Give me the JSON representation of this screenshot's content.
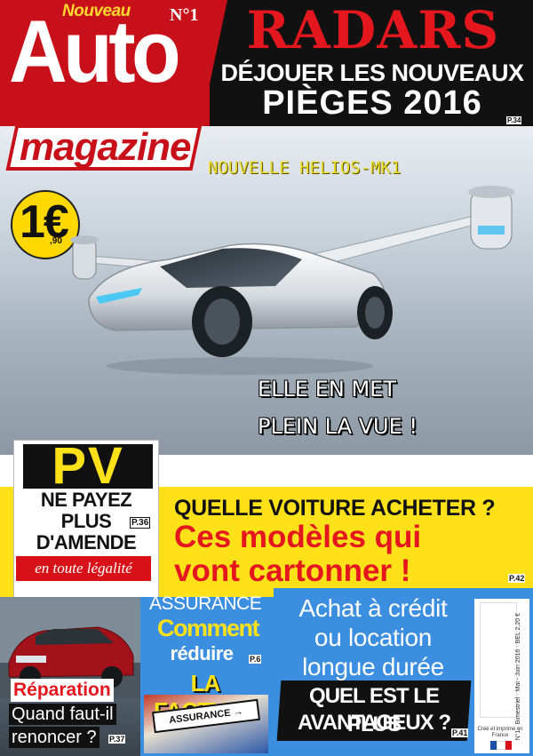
{
  "masthead": {
    "nouveau": "Nouveau",
    "auto": "Auto",
    "magazine": "magazine",
    "issue": "N°1",
    "price": "1€",
    "price_cents": ",90"
  },
  "headline": {
    "radars": "RADARS",
    "line1": "DÉJOUER LES NOUVEAUX",
    "line2": "PIÈGES 2016",
    "page": "P.34"
  },
  "hero": {
    "title": "NOUVELLE HELIOS-MK1",
    "tagline1": "ELLE EN MET",
    "tagline2": "PLEIN LA VUE !"
  },
  "pv": {
    "heading": "PV",
    "line1": "NE PAYEZ",
    "line2": "PLUS",
    "line3": "D'AMENDE",
    "page": "P.36",
    "ribbon": "en toute légalité"
  },
  "feature": {
    "question": "QUELLE VOITURE ACHETER ?",
    "headline1": "Ces modèles qui",
    "headline2": "vont cartonner !",
    "page": "P.42"
  },
  "repair": {
    "title": "Réparation",
    "line1": "Quand faut-il",
    "line2": "renoncer ?",
    "page": "P.37"
  },
  "insurance": {
    "title": "ASSURANCE",
    "comment": "Comment",
    "reduire": "réduire",
    "page": "P.6",
    "facture": "LA FACTURE",
    "sign": "ASSURANCE →"
  },
  "credit": {
    "line1": "Achat à crédit",
    "line2": "ou location",
    "line3": "longue durée",
    "q1": "QUEL EST LE PLUS",
    "q2": "AVANTAGEUX ?",
    "page": "P.41"
  },
  "legal": {
    "vertical": "N°1 · Bimestriel · Mai - Juin 2016 · BEL 2,20 €",
    "made_in": "Créé et imprimé en France"
  },
  "colors": {
    "brand_red": "#c8101a",
    "accent_yellow": "#ffe11a",
    "panel_blue": "#3c8fe0"
  }
}
